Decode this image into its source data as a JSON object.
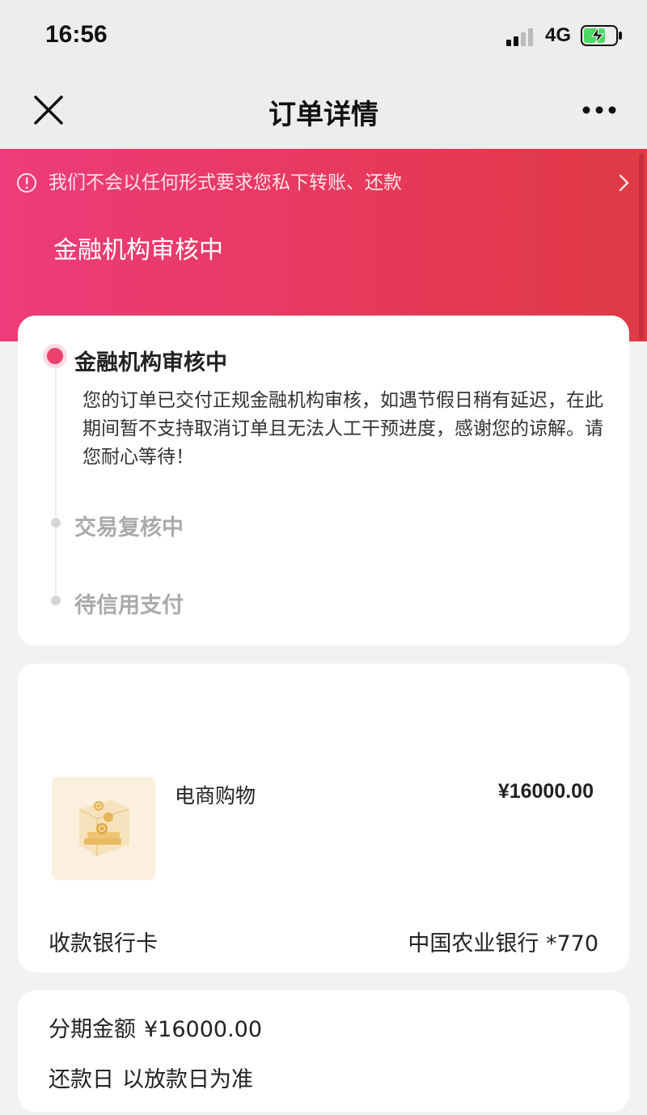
{
  "status_bar": {
    "time": "16:56",
    "network": "4G"
  },
  "nav": {
    "title": "订单详情",
    "close_icon": "close-icon",
    "more_icon": "more-icon"
  },
  "hero": {
    "notice": "我们不会以任何形式要求您私下转账、还款",
    "status": "金融机构审核中"
  },
  "timeline": {
    "active": {
      "title": "金融机构审核中",
      "description": "您的订单已交付正规金融机构审核，如遇节假日稍有延迟，在此期间暂不支持取消订单且无法人工干预进度，感谢您的谅解。请您耐心等待！"
    },
    "steps": [
      {
        "title": "交易复核中"
      },
      {
        "title": "待信用支付"
      }
    ]
  },
  "product": {
    "name": "电商购物",
    "price": "¥16000.00",
    "image_icon": "gold-coin-box-icon"
  },
  "bank": {
    "label": "收款银行卡",
    "value": "中国农业银行 *770"
  },
  "installment": {
    "amount_label": "分期金额",
    "amount_value": "¥16000.00",
    "repay_label": "还款日",
    "repay_value": "以放款日为准"
  },
  "colors": {
    "brand_gradient_start": "#ec3c7b",
    "brand_gradient_end": "#e03a44",
    "active_dot": "#e8416c"
  }
}
